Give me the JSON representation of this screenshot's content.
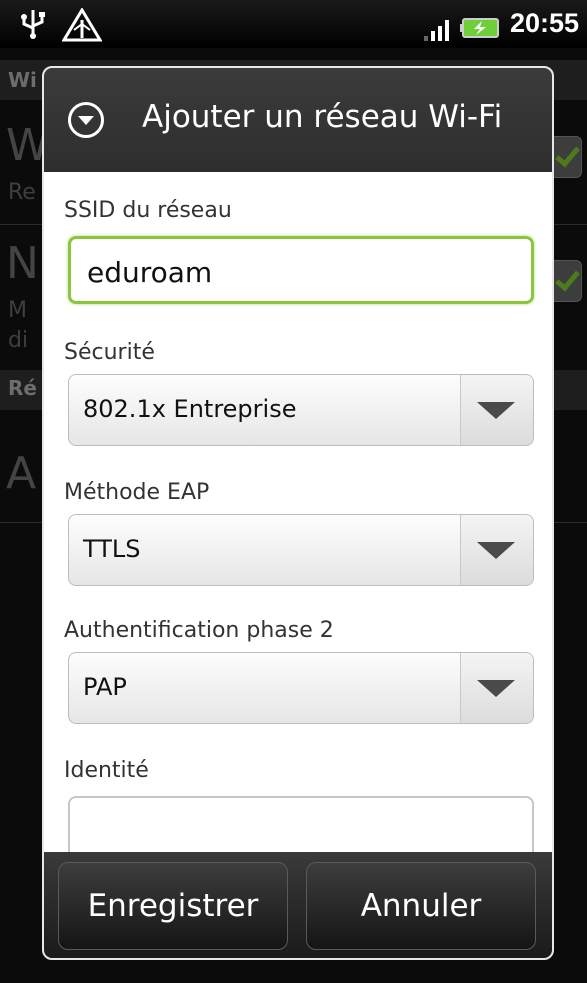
{
  "status_bar": {
    "time": "20:55",
    "icons": [
      "usb-icon",
      "warning-icon",
      "signal-icon",
      "battery-charging-icon"
    ]
  },
  "background": {
    "header_fragment": "Wi",
    "item1_big": "W",
    "item1_small": "Re",
    "item2_big": "N",
    "item2_small_1": "M",
    "item2_small_2": "di",
    "section_fragment": "Ré",
    "item3_big": "A"
  },
  "dialog": {
    "title": "Ajouter un réseau Wi-Fi",
    "ssid_label": "SSID du réseau",
    "ssid_value": "eduroam",
    "security_label": "Sécurité",
    "security_value": "802.1x Entreprise",
    "eap_label": "Méthode EAP",
    "eap_value": "TTLS",
    "phase2_label": "Authentification phase 2",
    "phase2_value": "PAP",
    "identity_label": "Identité",
    "identity_value": "",
    "save_label": "Enregistrer",
    "cancel_label": "Annuler"
  },
  "colors": {
    "focus_accent": "#8cc63f",
    "title_bar": "#333333"
  }
}
